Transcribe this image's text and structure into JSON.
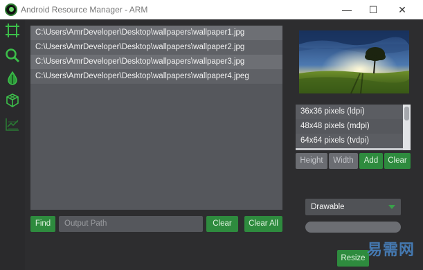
{
  "window": {
    "title": "Android Resource Manager - ARM",
    "minimize_glyph": "—",
    "maximize_glyph": "☐",
    "close_glyph": "✕"
  },
  "sidebar": {
    "icons": [
      "crop-icon",
      "search-icon",
      "drop-icon",
      "cube-icon",
      "chart-icon"
    ]
  },
  "files": [
    "C:\\Users\\AmrDeveloper\\Desktop\\wallpapers\\wallpaper1.jpg",
    "C:\\Users\\AmrDeveloper\\Desktop\\wallpapers\\wallpaper2.jpg",
    "C:\\Users\\AmrDeveloper\\Desktop\\wallpapers\\wallpaper3.jpg",
    "C:\\Users\\AmrDeveloper\\Desktop\\wallpapers\\wallpaper4.jpeg"
  ],
  "bottom": {
    "find_label": "Find",
    "output_placeholder": "Output Path",
    "clear_label": "Clear",
    "clear_all_label": "Clear All"
  },
  "sizes": [
    "36x36 pixels (ldpi)",
    "48x48 pixels (mdpi)",
    "64x64 pixels (tvdpi)"
  ],
  "size_buttons": {
    "height_label": "Height",
    "width_label": "Width",
    "add_label": "Add",
    "clear_label": "Clear"
  },
  "dropdown": {
    "selected": "Drawable"
  },
  "progress": {
    "value": 0
  },
  "resize_label": "Resize",
  "watermark": "易需网",
  "colors": {
    "accent": "#2e8b3e",
    "background": "#2d2d2f",
    "list_bg": "#55575c"
  }
}
